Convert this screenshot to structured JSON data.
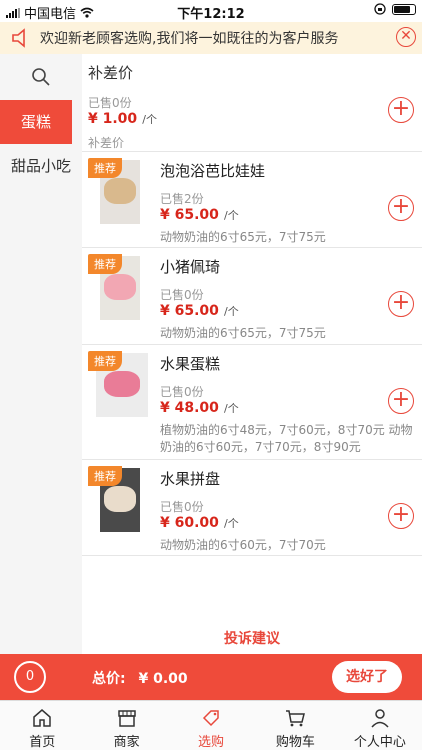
{
  "status": {
    "carrier": "中国电信",
    "time": "下午12:12"
  },
  "notice": {
    "text": "欢迎新老顾客选购,我们将一如既往的为客户服务"
  },
  "sidebar": {
    "items": [
      {
        "label": "蛋糕"
      },
      {
        "label": "甜品小吃"
      }
    ]
  },
  "section": {
    "title": "补差价"
  },
  "bucha": {
    "sold": "已售0份",
    "price": "¥ 1.00",
    "unit": "/个",
    "group_label": "补差价"
  },
  "products": [
    {
      "badge": "推荐",
      "name": "泡泡浴芭比娃娃",
      "sold": "已售2份",
      "price": "¥ 65.00",
      "unit": "/个",
      "desc": "动物奶油的6寸65元，7寸75元"
    },
    {
      "badge": "推荐",
      "name": "小猪佩琦",
      "sold": "已售0份",
      "price": "¥ 65.00",
      "unit": "/个",
      "desc": "动物奶油的6寸65元，7寸75元"
    },
    {
      "badge": "推荐",
      "name": "水果蛋糕",
      "sold": "已售0份",
      "price": "¥ 48.00",
      "unit": "/个",
      "desc": "植物奶油的6寸48元，7寸60元，8寸70元 动物奶油的6寸60元，7寸70元，8寸90元"
    },
    {
      "badge": "推荐",
      "name": "水果拼盘",
      "sold": "已售0份",
      "price": "¥ 60.00",
      "unit": "/个",
      "desc": "动物奶油的6寸60元，7寸70元"
    }
  ],
  "complaint": "投诉建议",
  "cart": {
    "count": "0",
    "total_label": "总价:",
    "total_value": "¥ 0.00",
    "checkout": "选好了"
  },
  "tabs": [
    {
      "label": "首页"
    },
    {
      "label": "商家"
    },
    {
      "label": "选购"
    },
    {
      "label": "购物车"
    },
    {
      "label": "个人中心"
    }
  ],
  "colors": {
    "accent": "#ef4b3a",
    "badge": "#f3872b",
    "notice_bg": "#fdf3dd"
  }
}
